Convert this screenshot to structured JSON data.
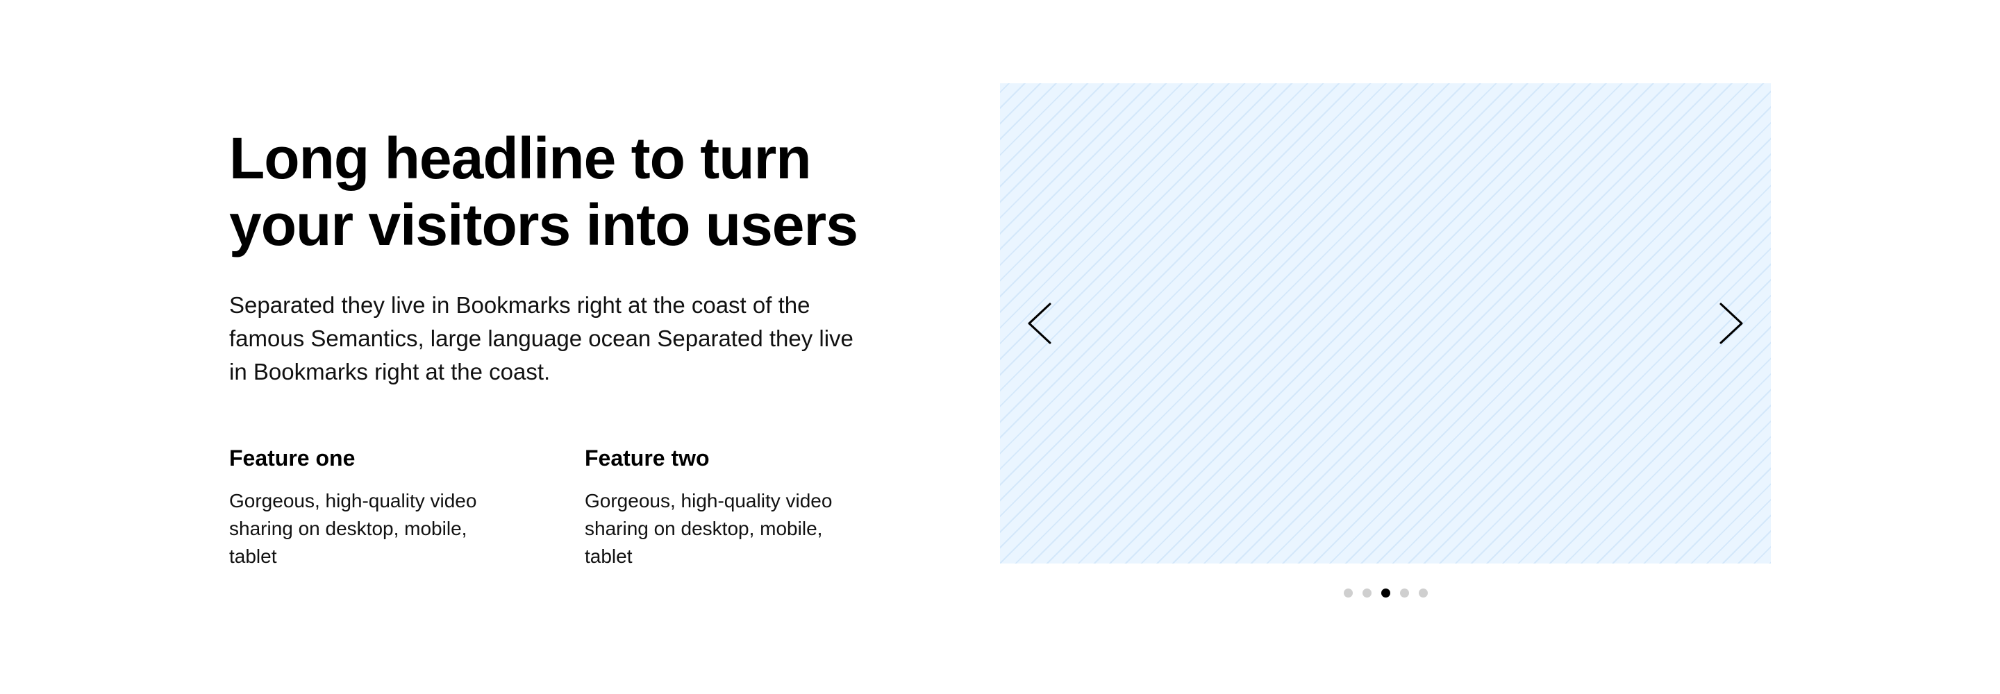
{
  "hero": {
    "headline_line1": "Long headline to turn",
    "headline_line2": "your visitors into users",
    "description": "Separated they live in Bookmarks right at the coast of the famous Semantics, large language ocean Separated they live in Bookmarks right at the coast."
  },
  "features": [
    {
      "title": "Feature one",
      "text": "Gorgeous, high-quality video sharing on desktop, mobile, tablet"
    },
    {
      "title": "Feature two",
      "text": "Gorgeous, high-quality video sharing on desktop, mobile, tablet"
    }
  ],
  "carousel": {
    "prev_icon": "chevron-left-icon",
    "next_icon": "chevron-right-icon",
    "slide_count": 5,
    "active_index": 2,
    "colors": {
      "background": "#eaf5ff",
      "dot": "#cfcfcf",
      "dot_active": "#000000"
    }
  }
}
